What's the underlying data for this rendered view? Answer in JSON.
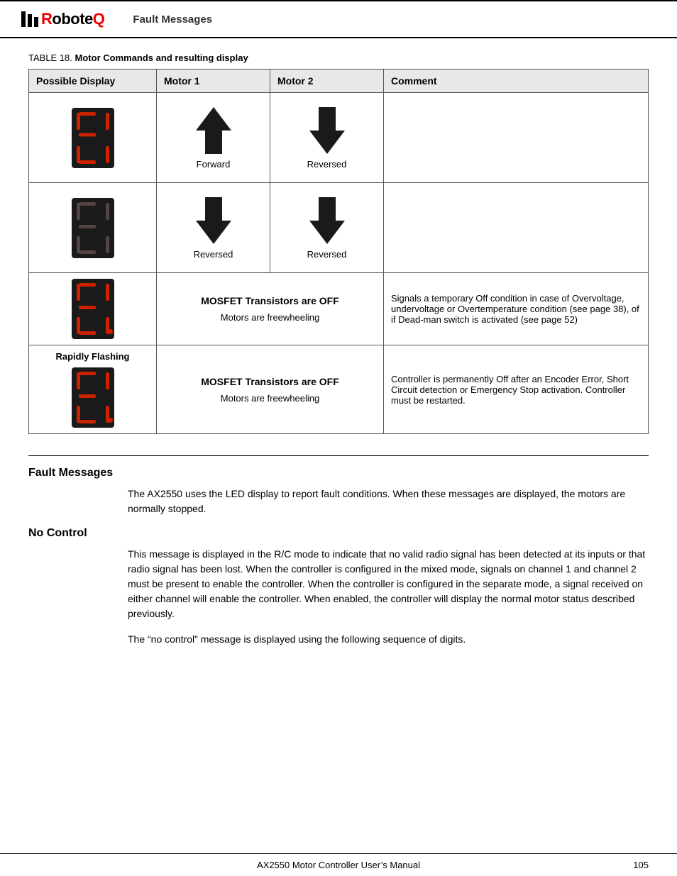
{
  "header": {
    "logo_text": "RoboteQ",
    "section_title": "Fault Messages"
  },
  "table": {
    "caption": "TABLE 18.",
    "caption_bold": "Motor Commands and resulting display",
    "headers": [
      "Possible Display",
      "Motor 1",
      "Motor 2",
      "Comment"
    ],
    "rows": [
      {
        "display": "led_normal",
        "motor1_label": "Forward",
        "motor2_label": "Reversed",
        "comment": ""
      },
      {
        "display": "led_dim",
        "motor1_label": "Reversed",
        "motor2_label": "Reversed",
        "comment": ""
      },
      {
        "display": "led_dot",
        "motor1_label": "MOSFET Transistors are OFF",
        "motor2_label": "Motors are freewheeling",
        "comment": "Signals a temporary Off condition in case of Overvoltage, undervoltage or Overtemperature condition (see page 38), of if Dead-man switch is activated (see page 52)"
      },
      {
        "display": "led_dot",
        "rapidly_flashing": "Rapidly Flashing",
        "motor1_label": "MOSFET Transistors are OFF",
        "motor2_label": "Motors are freewheeling",
        "comment": "Controller is permanently Off after an Encoder Error, Short Circuit detection or Emergency Stop activation. Controller must be restarted."
      }
    ]
  },
  "sections": {
    "fault_messages": {
      "heading": "Fault Messages",
      "body": "The AX2550 uses the LED display to report fault conditions. When these messages are displayed, the motors are normally stopped."
    },
    "no_control": {
      "heading": "No Control",
      "body1": "This message is displayed in the R/C mode to indicate that no valid radio signal has been detected at its inputs or that radio signal has been lost. When the controller is configured in the mixed mode, signals on channel 1 and channel 2 must be present to enable the controller. When the controller is configured in the separate mode, a signal received on either channel will enable the controller. When enabled, the controller will display the normal motor status described previously.",
      "body2": "The “no control” message is displayed using the following sequence of digits."
    }
  },
  "footer": {
    "center": "AX2550 Motor Controller User’s Manual",
    "page": "105"
  }
}
